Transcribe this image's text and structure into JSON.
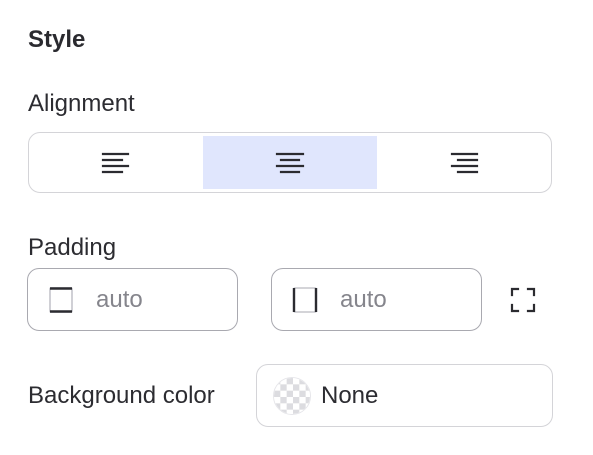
{
  "panel": {
    "heading": "Style"
  },
  "alignment": {
    "label": "Alignment",
    "options": [
      {
        "name": "left",
        "icon": "align-left-icon"
      },
      {
        "name": "center",
        "icon": "align-center-icon"
      },
      {
        "name": "right",
        "icon": "align-right-icon"
      }
    ],
    "selected": "center",
    "selected_color": "#e0e6fd"
  },
  "padding": {
    "label": "Padding",
    "vertical": {
      "value": "auto",
      "icon": "padding-vertical-icon"
    },
    "horizontal": {
      "value": "auto",
      "icon": "padding-horizontal-icon"
    },
    "link_icon": "padding-all-sides-icon"
  },
  "background": {
    "label": "Background color",
    "value": "None",
    "swatch_icon": "transparent-checkerboard-icon"
  }
}
